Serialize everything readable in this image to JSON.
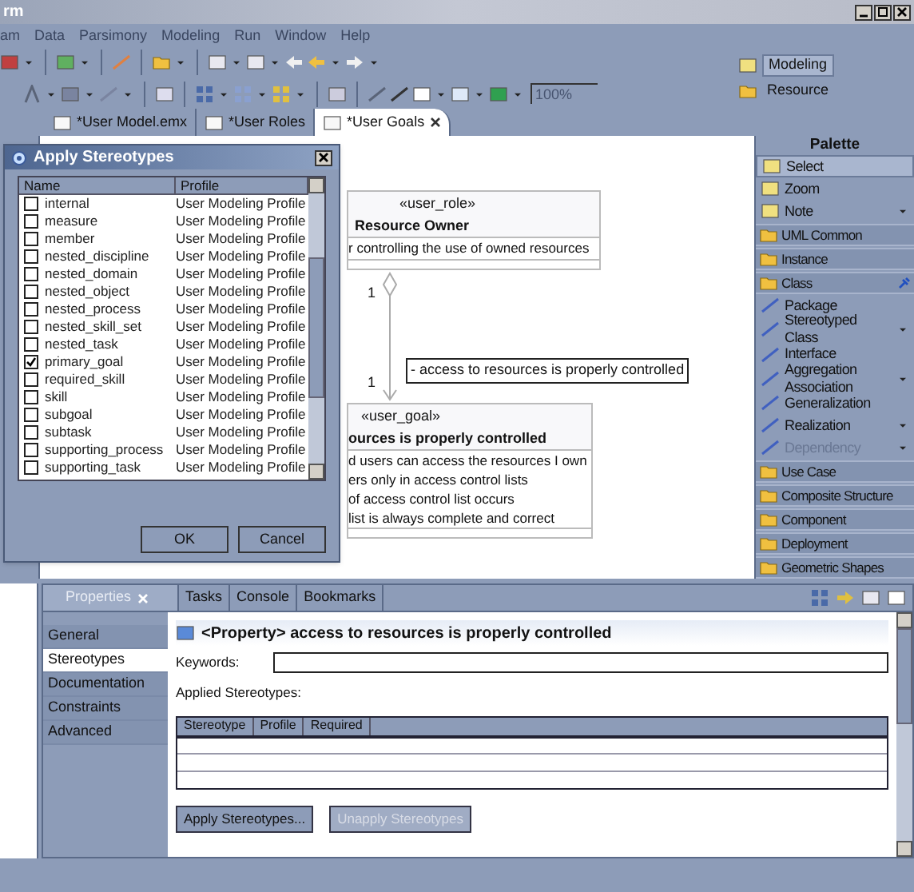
{
  "window": {
    "title": "rm"
  },
  "menu": [
    "am",
    "Data",
    "Parsimony",
    "Modeling",
    "Run",
    "Window",
    "Help"
  ],
  "toolbar": {
    "zoom": "100%"
  },
  "perspectives": [
    {
      "label": "Modeling",
      "selected": true
    },
    {
      "label": "Resource",
      "selected": false
    }
  ],
  "editor_tabs": [
    {
      "label": "*User Model.emx",
      "selected": false
    },
    {
      "label": "*User Roles",
      "selected": false
    },
    {
      "label": "*User Goals",
      "selected": true
    }
  ],
  "diagram": {
    "role_box": {
      "stereotype": "«user_role»",
      "name": "Resource Owner",
      "attributes": [
        "r controlling the use of owned resources"
      ]
    },
    "association": {
      "source_multiplicity": "1",
      "target_multiplicity": "1",
      "label": "- access to resources is properly controlled"
    },
    "goal_box": {
      "stereotype": "«user_goal»",
      "name": "ources is properly controlled",
      "attributes": [
        "d users can access the resources I own",
        "ers only in access control lists",
        "of access control list occurs",
        "list is always complete and correct"
      ]
    }
  },
  "dialog": {
    "title": "Apply Stereotypes",
    "columns": [
      "Name",
      "Profile"
    ],
    "rows": [
      {
        "name": "internal",
        "profile": "User Modeling Profile",
        "checked": false
      },
      {
        "name": "measure",
        "profile": "User Modeling Profile",
        "checked": false
      },
      {
        "name": "member",
        "profile": "User Modeling Profile",
        "checked": false
      },
      {
        "name": "nested_discipline",
        "profile": "User Modeling Profile",
        "checked": false
      },
      {
        "name": "nested_domain",
        "profile": "User Modeling Profile",
        "checked": false
      },
      {
        "name": "nested_object",
        "profile": "User Modeling Profile",
        "checked": false
      },
      {
        "name": "nested_process",
        "profile": "User Modeling Profile",
        "checked": false
      },
      {
        "name": "nested_skill_set",
        "profile": "User Modeling Profile",
        "checked": false
      },
      {
        "name": "nested_task",
        "profile": "User Modeling Profile",
        "checked": false
      },
      {
        "name": "primary_goal",
        "profile": "User Modeling Profile",
        "checked": true
      },
      {
        "name": "required_skill",
        "profile": "User Modeling Profile",
        "checked": false
      },
      {
        "name": "skill",
        "profile": "User Modeling Profile",
        "checked": false
      },
      {
        "name": "subgoal",
        "profile": "User Modeling Profile",
        "checked": false
      },
      {
        "name": "subtask",
        "profile": "User Modeling Profile",
        "checked": false
      },
      {
        "name": "supporting_process",
        "profile": "User Modeling Profile",
        "checked": false
      },
      {
        "name": "supporting_task",
        "profile": "User Modeling Profile",
        "checked": false
      }
    ],
    "buttons": [
      "OK",
      "Cancel"
    ]
  },
  "palette": {
    "title": "Palette",
    "items": [
      {
        "kind": "tool",
        "label": "Select",
        "selected": true,
        "dropdown": false,
        "disabled": false
      },
      {
        "kind": "tool",
        "label": "Zoom",
        "selected": false,
        "dropdown": false,
        "disabled": false
      },
      {
        "kind": "tool",
        "label": "Note",
        "selected": false,
        "dropdown": true,
        "disabled": false
      },
      {
        "kind": "drawer",
        "label": "UML Common",
        "pinned": false
      },
      {
        "kind": "drawer",
        "label": "Instance",
        "pinned": false
      },
      {
        "kind": "drawer",
        "label": "Class",
        "pinned": true
      },
      {
        "kind": "tool",
        "label": "Package",
        "selected": false,
        "dropdown": false,
        "disabled": false
      },
      {
        "kind": "tool",
        "label": "Stereotyped Class",
        "selected": false,
        "dropdown": true,
        "disabled": false
      },
      {
        "kind": "tool",
        "label": "Interface",
        "selected": false,
        "dropdown": false,
        "disabled": false
      },
      {
        "kind": "tool",
        "label": "Aggregation Association",
        "selected": false,
        "dropdown": true,
        "disabled": false
      },
      {
        "kind": "tool",
        "label": "Generalization",
        "selected": false,
        "dropdown": false,
        "disabled": false
      },
      {
        "kind": "tool",
        "label": "Realization",
        "selected": false,
        "dropdown": true,
        "disabled": false
      },
      {
        "kind": "tool",
        "label": "Dependency",
        "selected": false,
        "dropdown": true,
        "disabled": true
      },
      {
        "kind": "drawer",
        "label": "Use Case",
        "pinned": false
      },
      {
        "kind": "drawer",
        "label": "Composite Structure",
        "pinned": false
      },
      {
        "kind": "drawer",
        "label": "Component",
        "pinned": false
      },
      {
        "kind": "drawer",
        "label": "Deployment",
        "pinned": false
      },
      {
        "kind": "drawer",
        "label": "Geometric Shapes",
        "pinned": false
      }
    ]
  },
  "view_tabs": [
    {
      "label": "Properties",
      "selected": true
    },
    {
      "label": "Tasks",
      "selected": false
    },
    {
      "label": "Console",
      "selected": false
    },
    {
      "label": "Bookmarks",
      "selected": false
    }
  ],
  "properties": {
    "sections": [
      {
        "label": "General",
        "selected": false
      },
      {
        "label": "Stereotypes",
        "selected": true
      },
      {
        "label": "Documentation",
        "selected": false
      },
      {
        "label": "Constraints",
        "selected": false
      },
      {
        "label": "Advanced",
        "selected": false
      }
    ],
    "heading": "<Property> access to resources is properly controlled",
    "keywords_label": "Keywords:",
    "applied_label": "Applied Stereotypes:",
    "table_columns": [
      "Stereotype",
      "Profile",
      "Required"
    ],
    "buttons": [
      {
        "label": "Apply Stereotypes...",
        "disabled": false
      },
      {
        "label": "Unapply Stereotypes",
        "disabled": true
      }
    ]
  }
}
